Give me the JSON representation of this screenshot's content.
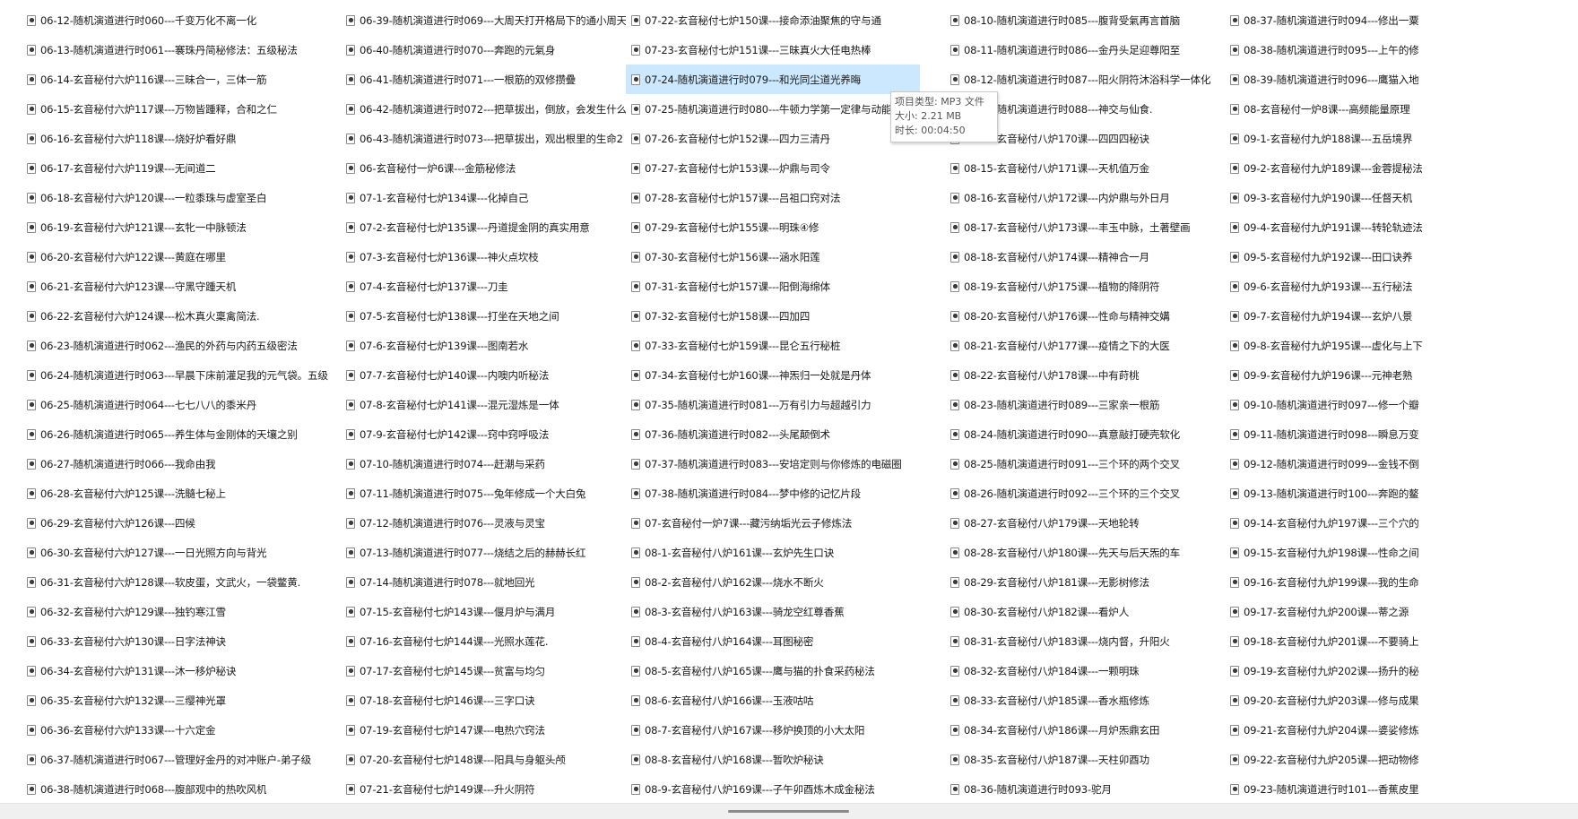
{
  "columns": [
    {
      "items": [
        "06-12-随机演道进行时060---千变万化不离一化",
        "06-13-随机演道进行时061---褰珠丹简秘修法：五级秘法",
        "06-14-玄音秘付六炉116课---三昧合一，三体一筋",
        "06-15-玄音秘付六炉117课---万物皆踵释，合和之仁",
        "06-16-玄音秘付六炉118课---烧好炉看好鼎",
        "06-17-玄音秘付六炉119课---无间道二",
        "06-18-玄音秘付六炉120课---一粒黍珠与虚室圣白",
        "06-19-玄音秘付六炉121课---玄牝一中脉顿法",
        "06-20-玄音秘付六炉122课---黄庭在哪里",
        "06-21-玄音秘付六炉123课---守黑守踵天机",
        "06-22-玄音秘付六炉124课---松木真火稟禽简法.",
        "06-23-随机演道进行时062---渔民的外药与内药五级密法",
        "06-24-随机演道进行时063---早晨下床前灌足我的元气袋。五级",
        "06-25-随机演道进行时064---七七八八的黍米丹",
        "06-26-随机演道进行时065---养生体与金刚体的天壤之别",
        "06-27-随机演道进行时066---我命由我",
        "06-28-玄音秘付六炉125课---洗髓七秘上",
        "06-29-玄音秘付六炉126课---四候",
        "06-30-玄音秘付六炉127课---一日光照方向与背光",
        "06-31-玄音秘付六炉128课---软皮蛋，文武火，一袋鳖黄.",
        "06-32-玄音秘付六炉129课---独钓寒江雪",
        "06-33-玄音秘付六炉130课---日字法神诀",
        "06-34-玄音秘付六炉131课---沐一移炉秘诀",
        "06-35-玄音秘付六炉132课---三缨神光罩",
        "06-36-玄音秘付六炉133课---十六定金",
        "06-37-随机演道进行时067---管理好金丹的对冲账户-弟子级",
        "06-38-随机演道进行时068---腹部观中的热吹风机"
      ]
    },
    {
      "items": [
        "06-39-随机演道进行时069---大周天打开格局下的通小周天",
        "06-40-随机演道进行时070---奔跑的元氣身",
        "06-41-随机演道进行时071---一根筋的双修攒疊",
        "06-42-随机演道进行时072---把草拔出，倒放，会发生什么1",
        "06-43-随机演道进行时073---把草拔出，观出根里的生命2",
        "06-玄音秘付一炉6课---金筋秘修法",
        "07-1-玄音秘付七炉134课---化掉自己",
        "07-2-玄音秘付七炉135课---丹道提金阴的真实用意",
        "07-3-玄音秘付七炉136课---神火点坎枝",
        "07-4-玄音秘付七炉137课---刀圭",
        "07-5-玄音秘付七炉138课---打坐在天地之间",
        "07-6-玄音秘付七炉139课---图南若水",
        "07-7-玄音秘付七炉140课---内噢内听秘法",
        "07-8-玄音秘付七炉141课---混元湿炼是一体",
        "07-9-玄音秘付七炉142课---窍中窍呼吸法",
        "07-10-随机演道进行时074---赶潮与采药",
        "07-11-随机演道进行时075---兔年修成一个大白兔",
        "07-12-随机演道进行时076---灵液与灵宝",
        "07-13-随机演道进行时077---烧结之后的赫赫长红",
        "07-14-随机演道进行时078---就地回光",
        "07-15-玄音秘付七炉143课---偃月炉与满月",
        "07-16-玄音秘付七炉144课---光照水莲花.",
        "07-17-玄音秘付七炉145课---贫富与均匀",
        "07-18-玄音秘付七炉146课---三字口诀",
        "07-19-玄音秘付七炉147课---电热穴窍法",
        "07-20-玄音秘付七炉148课---阳具与身躯头颅",
        "07-21-玄音秘付七炉149课---升火阴符"
      ]
    },
    {
      "items": [
        "07-22-玄音秘付七炉150课---接命添油聚焦的守与通",
        "07-23-玄音秘付七炉151课---三昧真火大任电热棒",
        "07-24-随机演道进行时079---和光同尘道光养晦",
        "07-25-随机演道进行时080---牛顿力学第一定律与动能",
        "07-26-玄音秘付七炉152课---四力三清丹",
        "07-27-玄音秘付七炉153课---炉鼎与司令",
        "07-28-玄音秘付七炉157课---吕祖口窍对法",
        "07-29-玄音秘付七炉155课---明珠④修",
        "07-30-玄音秘付七炉156课---涵水阳莲",
        "07-31-玄音秘付七炉157课---阳倒海绵体",
        "07-32-玄音秘付七炉158课---四加四",
        "07-33-玄音秘付七炉159课---昆仑五行秘桩",
        "07-34-玄音秘付七炉160课---神炁归一处就是丹体",
        "07-35-随机演道进行时081---万有引力与超越引力",
        "07-36-随机演道进行时082---头尾颠倒术",
        "07-37-随机演道进行时083---安培定则与你修炼的电磁圈",
        "07-38-随机演道进行时084---梦中修的记忆片段",
        "07-玄音秘付一炉7课---藏污纳垢光云子修炼法",
        "08-1-玄音秘付八炉161课---玄炉先生口诀",
        "08-2-玄音秘付八炉162课---烧水不断火",
        "08-3-玄音秘付八炉163课---骑龙空红尊香蕉",
        "08-4-玄音秘付八炉164课---耳图秘密",
        "08-5-玄音秘付八炉165课---鹰与猫的扑食采药秘法",
        "08-6-玄音秘付八炉166课---玉液咕咕",
        "08-7-玄音秘付八炉167课---移炉换顶的小大太阳",
        "08-8-玄音秘付八炉168课---暂吹炉秘诀",
        "08-9-玄音秘付八炉169课---子午卯酉炼木成金秘法"
      ]
    },
    {
      "items": [
        "08-10-随机演道进行时085---腹背受氣再言首脑",
        "08-11-随机演道进行时086---金丹头足迎尊阳至",
        "08-12-随机演道进行时087---阳火阴符沐浴科学一体化",
        "08-13-随机演道进行时088---神交与仙食.",
        "08-14-玄音秘付八炉170课---四四四秘诀",
        "08-15-玄音秘付八炉171课---天机值万金",
        "08-16-玄音秘付八炉172课---内炉鼎与外日月",
        "08-17-玄音秘付八炉173课---丰玉中脉，土著壁画",
        "08-18-玄音秘付八炉174课---精神合一月",
        "08-19-玄音秘付八炉175课---植物的降阴符",
        "08-20-玄音秘付八炉176课---性命与精神交媾",
        "08-21-玄音秘付八炉177课---疫情之下的大医",
        "08-22-玄音秘付八炉178课---中有莳桃",
        "08-23-随机演道进行时089---三家亲一根筋",
        "08-24-随机演道进行时090---真意敲打硬壳软化",
        "08-25-随机演道进行时091---三个环的两个交叉",
        "08-26-随机演道进行时092---三个环的三个交叉",
        "08-27-玄音秘付八炉179课---天地轮转",
        "08-28-玄音秘付八炉180课---先天与后天炁的车",
        "08-29-玄音秘付八炉181课---无影树修法",
        "08-30-玄音秘付八炉182课---看炉人",
        "08-31-玄音秘付八炉183课---烧内督，升阳火",
        "08-32-玄音秘付八炉184课---一颗明珠",
        "08-33-玄音秘付八炉185课---香水瓶修炼",
        "08-34-玄音秘付八炉186课---月炉炁鼎玄田",
        "08-35-玄音秘付八炉187课---天柱卯酉功",
        "08-36-随机演道进行时093-驼月"
      ]
    },
    {
      "items": [
        "08-37-随机演道进行时094---修出一粟",
        "08-38-随机演道进行时095---上午的修",
        "08-39-随机演道进行时096---鹰猫入地",
        "08-玄音秘付一炉8课---高频能量原理",
        "09-1-玄音秘付九炉188课---五岳境界",
        "09-2-玄音秘付九炉189课---金蓉提秘法",
        "09-3-玄音秘付九炉190课---任督天机",
        "09-4-玄音秘付九炉191课---转轮轨迹法",
        "09-5-玄音秘付九炉192课---田口诀养",
        "09-6-玄音秘付九炉193课---五行秘法",
        "09-7-玄音秘付九炉194课---玄炉八景",
        "09-8-玄音秘付九炉195课---虚化与上下",
        "09-9-玄音秘付九炉196课---元神老熟",
        "09-10-随机演道进行时097---修一个瓣",
        "09-11-随机演道进行时098---瞬息万变",
        "09-12-随机演道进行时099---金钱不倒",
        "09-13-随机演道进行时100---奔跑的鳌",
        "09-14-玄音秘付九炉197课---三个穴的",
        "09-15-玄音秘付九炉198课---性命之间",
        "09-16-玄音秘付九炉199课---我的生命",
        "09-17-玄音秘付九炉200课---蒂之源",
        "09-18-玄音秘付九炉201课---不要骑上",
        "09-19-玄音秘付九炉202课---扬升的秘",
        "09-20-玄音秘付九炉203课---修与成果",
        "09-21-玄音秘付九炉204课---婆娑修炼",
        "09-22-玄音秘付九炉205课---把动物修",
        "09-23-随机演道进行时101---香蕉皮里"
      ]
    }
  ],
  "selected": {
    "column": 2,
    "index": 2
  },
  "tooltip": {
    "type_line": "项目类型: MP3 文件",
    "size_line": "大小: 2.21 MB",
    "duration_line": "时长: 00:04:50"
  },
  "icons": {
    "file": "mp3-file-icon"
  },
  "colors": {
    "selection": "#cce8ff",
    "background": "#ffffff",
    "scrollbar_thumb": "#8a8a8a"
  }
}
